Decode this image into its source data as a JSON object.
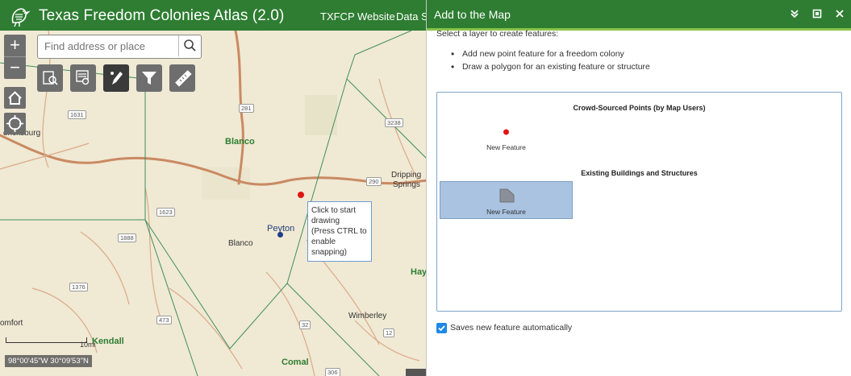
{
  "header": {
    "title": "Texas Freedom Colonies Atlas (2.0)",
    "links": [
      "TXFCP Website",
      "Data Sc"
    ]
  },
  "map": {
    "search_placeholder": "Find address or place",
    "zoom_in": "+",
    "zoom_out": "−",
    "tools": [
      "search-layer-icon",
      "query-icon",
      "draw-pen-icon",
      "filter-icon",
      "measure-icon"
    ],
    "places": [
      {
        "name": "Blanco",
        "style": "green"
      },
      {
        "name": "Blanco",
        "style": "plain"
      },
      {
        "name": "Peyton",
        "style": "blue"
      },
      {
        "name": "ericksburg",
        "style": "plain"
      },
      {
        "name": "Dripping",
        "style": "plain"
      },
      {
        "name": "Springs",
        "style": "plain"
      },
      {
        "name": "Hay",
        "style": "green"
      },
      {
        "name": "Wimberley",
        "style": "plain"
      },
      {
        "name": "Kendall",
        "style": "green"
      },
      {
        "name": "Comal",
        "style": "green"
      },
      {
        "name": "omfort",
        "style": "plain"
      }
    ],
    "shields": [
      "1631",
      "281",
      "1623",
      "1888",
      "1376",
      "473",
      "32",
      "12",
      "290",
      "3238",
      "306"
    ],
    "tooltip": {
      "line1": "Click to start drawing",
      "line2": "(Press CTRL to enable snapping)"
    },
    "scale_label": "10mi",
    "coordinates": "98°00'45\"W 30°09'53\"N",
    "colors": {
      "point": "#e01515",
      "peyton_point": "#1f3f8a",
      "roads": "#c98a62",
      "boundaries": "#3f8f5f"
    }
  },
  "panel": {
    "title": "Add to the Map",
    "instructions": "Select a layer to create features:",
    "steps": [
      "Add new point feature for a freedom colony",
      "Draw a polygon for an existing feature or structure"
    ],
    "groups": [
      {
        "heading": "Crowd-Sourced Points (by Map Users)",
        "item_label": "New Feature"
      },
      {
        "heading": "Existing Buildings and Structures",
        "item_label": "New Feature"
      }
    ],
    "autosave_label": "Saves new feature automatically",
    "autosave_checked": true
  }
}
